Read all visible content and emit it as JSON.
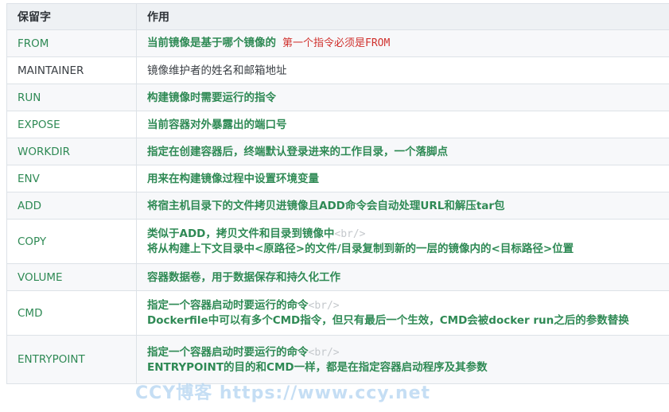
{
  "header": {
    "col1": "保留字",
    "col2": "作用"
  },
  "rows": [
    {
      "key": "FROM",
      "desc": "当前镜像是基于哪个镜像的",
      "note": "第一个指令必须是FROM"
    },
    {
      "key": "MAINTAINER",
      "desc": "镜像维护者的姓名和邮箱地址"
    },
    {
      "key": "RUN",
      "desc": "构建镜像时需要运行的指令"
    },
    {
      "key": "EXPOSE",
      "desc": "当前容器对外暴露出的端口号"
    },
    {
      "key": "WORKDIR",
      "desc": "指定在创建容器后，终端默认登录进来的工作目录，一个落脚点"
    },
    {
      "key": "ENV",
      "desc": "用来在构建镜像过程中设置环境变量"
    },
    {
      "key": "ADD",
      "desc": "将宿主机目录下的文件拷贝进镜像且ADD命令会自动处理URL和解压tar包"
    },
    {
      "key": "COPY",
      "line1": "类似于ADD，拷贝文件和目录到镜像中",
      "br": "<br/>",
      "line2": "将从构建上下文目录中<原路径>的文件/目录复制到新的一层的镜像内的<目标路径>位置"
    },
    {
      "key": "VOLUME",
      "desc": "容器数据卷，用于数据保存和持久化工作"
    },
    {
      "key": "CMD",
      "line1": "指定一个容器启动时要运行的命令",
      "br": "<br/>",
      "line2": "Dockerfile中可以有多个CMD指令，但只有最后一个生效，CMD会被docker run之后的参数替换"
    },
    {
      "key": "ENTRYPOINT",
      "line1": "指定一个容器启动时要运行的命令",
      "br": "<br/>",
      "line2": "ENTRYPOINT的目的和CMD一样，都是在指定容器启动程序及其参数"
    }
  ],
  "watermark": "CCY博客 https://www.ccy.net"
}
